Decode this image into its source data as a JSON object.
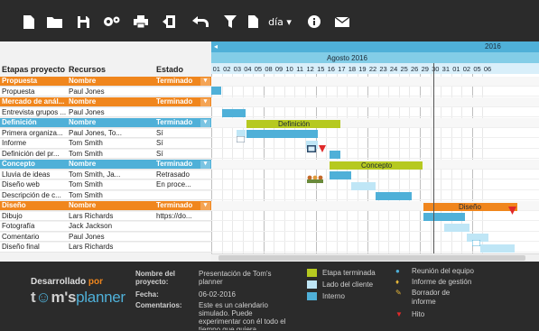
{
  "toolbar": {
    "day_select": "día ▾"
  },
  "grid": {
    "headers": {
      "col1": "Etapas proyecto",
      "col2": "Recursos",
      "col3": "Estado"
    },
    "rows": [
      {
        "type": "group",
        "color": "orange",
        "c1": "Propuesta",
        "c2": "Nombre",
        "c3": "Terminado"
      },
      {
        "type": "task",
        "c1": "Propuesta",
        "c2": "Paul Jones",
        "c3": ""
      },
      {
        "type": "group",
        "color": "orange",
        "c1": "Mercado de anál...",
        "c2": "Nombre",
        "c3": "Terminado"
      },
      {
        "type": "task",
        "c1": "Entrevista grupos ...",
        "c2": "Paul Jones",
        "c3": ""
      },
      {
        "type": "group",
        "color": "blue",
        "c1": "Definición",
        "c2": "Nombre",
        "c3": "Terminado"
      },
      {
        "type": "task",
        "c1": "Primera organiza...",
        "c2": "Paul Jones, To...",
        "c3": "Sí"
      },
      {
        "type": "task",
        "c1": "Informe",
        "c2": "Tom Smith",
        "c3": "Sí"
      },
      {
        "type": "task",
        "c1": "Definición del pr...",
        "c2": "Tom Smith",
        "c3": "Sí"
      },
      {
        "type": "group",
        "color": "blue",
        "c1": "Concepto",
        "c2": "Nombre",
        "c3": "Terminado"
      },
      {
        "type": "task",
        "c1": "Lluvia de ideas",
        "c2": "Tom Smith, Ja...",
        "c3": "Retrasado"
      },
      {
        "type": "task",
        "c1": "Diseño web",
        "c2": "Tom Smith",
        "c3": "En proce..."
      },
      {
        "type": "task",
        "c1": "Descripción de c...",
        "c2": "Tom Smith",
        "c3": ""
      },
      {
        "type": "group",
        "color": "orange",
        "c1": "Diseño",
        "c2": "Nombre",
        "c3": "Terminado"
      },
      {
        "type": "task",
        "c1": "Dibujo",
        "c2": "Lars Richards",
        "c3": "https://do..."
      },
      {
        "type": "task",
        "c1": "Fotografía",
        "c2": "Jack Jackson",
        "c3": ""
      },
      {
        "type": "task",
        "c1": "Comentario",
        "c2": "Paul Jones",
        "c3": ""
      },
      {
        "type": "task",
        "c1": "Diseño final",
        "c2": "Lars Richards",
        "c3": ""
      }
    ]
  },
  "timeline": {
    "year_left": "◂",
    "year_right": "2016",
    "month": "Agosto 2016",
    "days": [
      "01",
      "02",
      "03",
      "04",
      "05",
      "08",
      "09",
      "10",
      "11",
      "12",
      "15",
      "16",
      "17",
      "18",
      "19",
      "22",
      "23",
      "24",
      "25",
      "26",
      "29",
      "30",
      "31",
      "01",
      "02",
      "05",
      "06"
    ],
    "bars": [
      {
        "label": "Definición"
      },
      {
        "label": "Concepto"
      },
      {
        "label": "Diseño"
      }
    ]
  },
  "footer": {
    "brand_top": "Desarrollado",
    "brand_por": "por",
    "brand_logo_a": "t",
    "brand_logo_b": "m's",
    "brand_logo_c": "planner",
    "fields": {
      "project_label": "Nombre del proyecto:",
      "project_value": "Presentación de Tom's planner",
      "date_label": "Fecha:",
      "date_value": "06-02-2016",
      "comments_label": "Comentarios:",
      "comments_value": "Este es un calendario simulado. Puede experimentar con él todo el tiempo que quiera."
    },
    "legend_colors": [
      {
        "label": "Etapa terminada",
        "color": "#b6c920"
      },
      {
        "label": "Lado del cliente",
        "color": "#bfe6f6"
      },
      {
        "label": "Interno",
        "color": "#4fb0d8"
      }
    ],
    "legend_icons": [
      {
        "label": "Reunión del equipo",
        "icon": "meeting-icon"
      },
      {
        "label": "Informe de gestión",
        "icon": "report-icon"
      },
      {
        "label": "Borrador de informe",
        "icon": "draft-icon"
      },
      {
        "label": "Hito",
        "icon": "milestone-icon"
      }
    ]
  }
}
